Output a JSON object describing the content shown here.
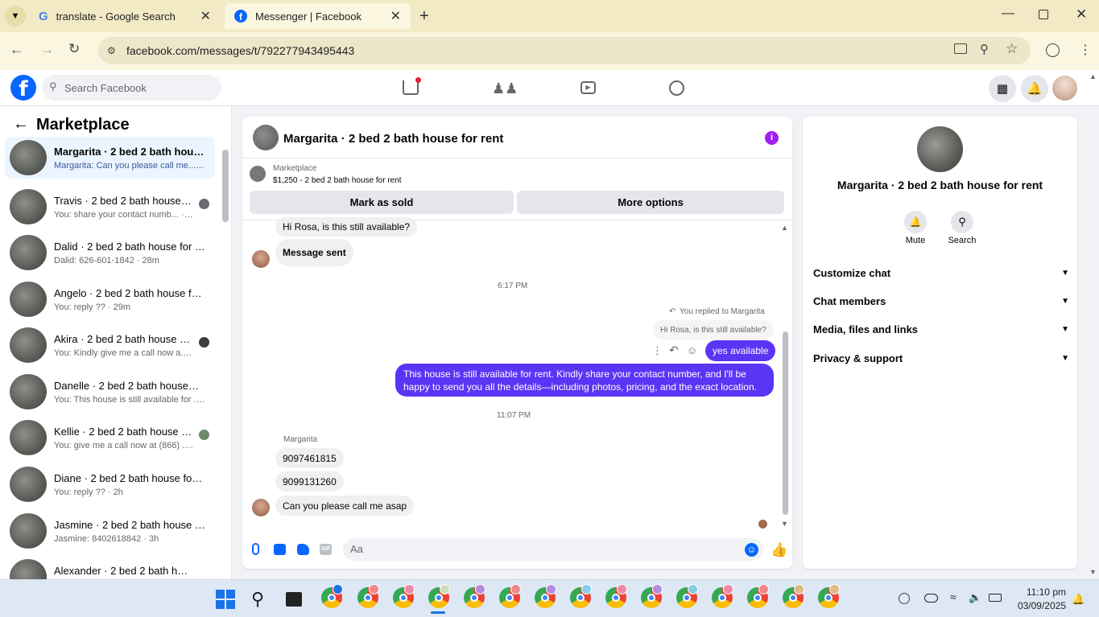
{
  "browser": {
    "tabs": [
      {
        "title": "translate - Google Search",
        "icon": "google-g-icon"
      },
      {
        "title": "Messenger | Facebook",
        "icon": "facebook-icon"
      }
    ],
    "url": "facebook.com/messages/t/792277943495443"
  },
  "fb": {
    "logo": "f",
    "search_placeholder": "Search Facebook"
  },
  "sidebar": {
    "title": "Marketplace",
    "conversations": [
      {
        "name": "Margarita · 2 bed 2 bath house for rent",
        "preview": "Margarita: Can you please call me... · 1m"
      },
      {
        "name": "Travis · 2 bed 2 bath house for rent",
        "preview": "You: share your contact numb... · 24m"
      },
      {
        "name": "Dalid · 2 bed 2 bath house for rent",
        "preview": "Dalid: 626-601-1842 · 28m"
      },
      {
        "name": "Angelo · 2 bed 2 bath house for rent",
        "preview": "You: reply ?? · 29m"
      },
      {
        "name": "Akira · 2 bed 2 bath house for rent",
        "preview": "You: Kindly give me a call now a... · 2h"
      },
      {
        "name": "Danelle · 2 bed 2 bath house for rent",
        "preview": "You: This house is still available for ... · 2h"
      },
      {
        "name": "Kellie · 2 bed 2 bath house for rent",
        "preview": "You: give me a call now at (866) ... · 2h"
      },
      {
        "name": "Diane · 2 bed 2 bath house for rent",
        "preview": "You: reply ?? · 2h"
      },
      {
        "name": "Jasmine · 2 bed 2 bath house for rent",
        "preview": "Jasmine: 8402618842 · 3h"
      },
      {
        "name": "Alexander · 2 bed 2 bath house for rent",
        "preview": ""
      }
    ]
  },
  "chat": {
    "title": "Margarita · 2 bed 2 bath house for rent",
    "listing_label": "Marketplace",
    "listing_detail": "$1,250 - 2 bed 2 bath house for rent",
    "mark_sold": "Mark as sold",
    "more_options": "More options",
    "msg_hi": "Hi Rosa, is this still available?",
    "msg_sent": "Message sent",
    "time1": "6:17 PM",
    "replied_to": "You replied to Margarita",
    "quote": "Hi Rosa, is this still available?",
    "msg_yes": "yes available",
    "msg_long_1": "This house is still available for rent. Kindly share your contact number, and I'll be",
    "msg_long_2": "happy to send you all the details—including photos, pricing, and the exact location.",
    "time2": "11:07 PM",
    "sender": "Margarita",
    "phone1": "9097461815",
    "phone2": "9099131260",
    "msg_call": "Can you please call me asap",
    "composer_placeholder": "Aa"
  },
  "details": {
    "name": "Margarita · 2 bed 2 bath house for rent",
    "mute": "Mute",
    "search": "Search",
    "sections": [
      "Customize chat",
      "Chat members",
      "Media, files and links",
      "Privacy & support"
    ]
  },
  "taskbar": {
    "time": "11:10 pm",
    "date": "03/09/2025"
  },
  "colors": {
    "accent": "#5b35f5",
    "facebook_blue": "#0866ff",
    "tab_bar": "#f2e9c5"
  }
}
